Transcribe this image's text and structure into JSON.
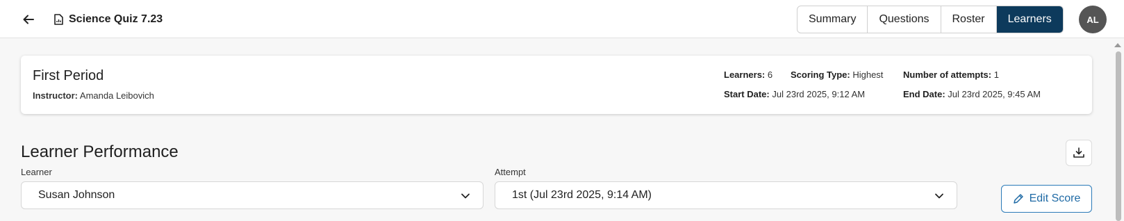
{
  "header": {
    "back_icon": "arrow-left-icon",
    "quiz_icon": "document-chart-icon",
    "title": "Science Quiz 7.23",
    "tabs": [
      {
        "label": "Summary",
        "active": false
      },
      {
        "label": "Questions",
        "active": false
      },
      {
        "label": "Roster",
        "active": false
      },
      {
        "label": "Learners",
        "active": true
      }
    ],
    "avatar_initials": "AL"
  },
  "class_info": {
    "name": "First Period",
    "instructor_label": "Instructor:",
    "instructor_name": "Amanda Leibovich",
    "learners_label": "Learners:",
    "learners_value": "6",
    "scoring_label": "Scoring Type:",
    "scoring_value": "Highest",
    "attempts_label": "Number of attempts:",
    "attempts_value": "1",
    "start_label": "Start Date:",
    "start_value": "Jul 23rd 2025, 9:12 AM",
    "end_label": "End Date:",
    "end_value": "Jul 23rd 2025, 9:45 AM"
  },
  "performance": {
    "title": "Learner Performance",
    "download_icon": "download-icon",
    "learner_label": "Learner",
    "learner_value": "Susan Johnson",
    "attempt_label": "Attempt",
    "attempt_value": "1st (Jul 23rd 2025, 9:14 AM)",
    "edit_label": "Edit Score",
    "edit_icon": "pencil-icon"
  },
  "colors": {
    "active_tab": "#0d3a5c",
    "avatar_bg": "#555555",
    "edit_accent": "#1f6aa5"
  }
}
